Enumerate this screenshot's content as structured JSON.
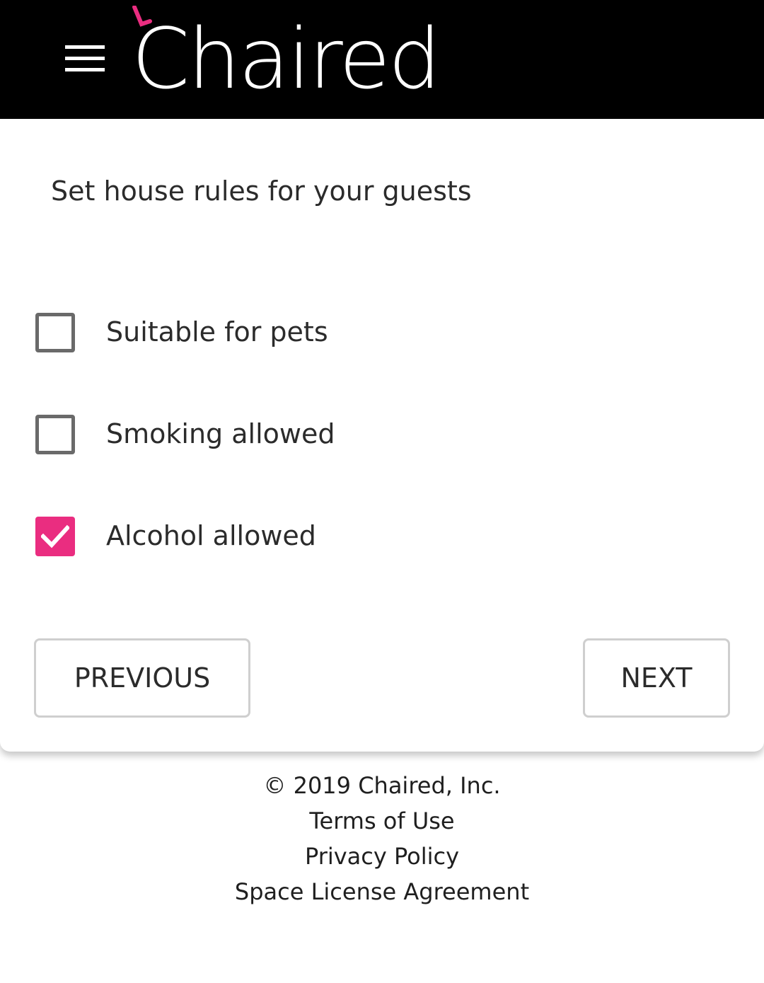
{
  "header": {
    "brand": "Chaired",
    "accent_color": "#ea2d80",
    "menu_icon": "hamburger-menu-icon"
  },
  "form": {
    "heading": "Set house rules for your guests",
    "options": [
      {
        "label": "Suitable for pets",
        "checked": false
      },
      {
        "label": "Smoking allowed",
        "checked": false
      },
      {
        "label": "Alcohol allowed",
        "checked": true
      }
    ],
    "previous_label": "PREVIOUS",
    "next_label": "NEXT"
  },
  "footer": {
    "copyright": "© 2019 Chaired, Inc.",
    "terms": "Terms of Use",
    "privacy": "Privacy Policy",
    "license": "Space License Agreement"
  },
  "colors": {
    "topbar": "#000000",
    "checkbox_checked": "#ea2d80",
    "checkbox_unchecked_border": "#6a6a6a"
  }
}
